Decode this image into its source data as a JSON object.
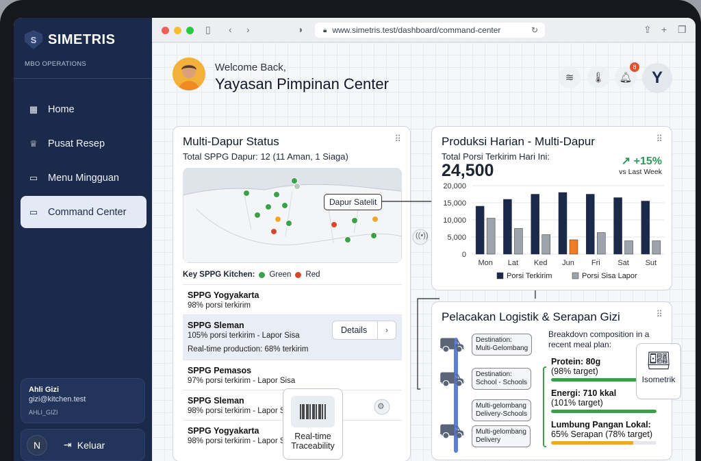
{
  "sidebar": {
    "brand": "SIMETRIS",
    "subtitle": "MBO OPERATIONS",
    "items": [
      {
        "label": "Home",
        "icon": "grid-icon"
      },
      {
        "label": "Pusat Resep",
        "icon": "chef-hat-icon"
      },
      {
        "label": "Menu Mingguan",
        "icon": "calendar-icon"
      },
      {
        "label": "Command Center",
        "icon": "calendar-icon"
      }
    ],
    "user": {
      "name": "Ahli Gizi",
      "email": "gizi@kitchen.test",
      "role": "AHLI_GIZI"
    },
    "logout": {
      "avatar": "N",
      "label": "Keluar"
    }
  },
  "browser": {
    "url": "www.simetris.test/dashboard/command-center"
  },
  "header": {
    "welcome": "Welcome Back,",
    "org": "Yayasan Pimpinan Center",
    "notifications": "8",
    "profile": "Y"
  },
  "status": {
    "title": "Multi-Dapur Status",
    "summary": "Total SPPG Dapur: 12 (11 Aman, 1 Siaga)",
    "callout": "Dapur Satelit",
    "key_label": "Key SPPG Kitchen:",
    "key_green": "Green",
    "key_red": "Red",
    "colors": {
      "green": "#3aa04a",
      "red": "#d9462e",
      "orange": "#f2a52b"
    },
    "rows": [
      {
        "name": "SPPG Yogyakarta",
        "detail": "98% porsi terkirim"
      },
      {
        "name": "SPPG Sleman",
        "detail": "105% porsi terkirim - Lapor Sisa",
        "extra": "Real-time production: 68% terkirim",
        "button": "Details"
      },
      {
        "name": "SPPG Pemasos",
        "detail": "97% porsi terkirim - Lapor Sisa"
      },
      {
        "name": "SPPG Sleman",
        "detail": "98% porsi terkirim - Lapor Sisa"
      },
      {
        "name": "SPPG Yogyakarta",
        "detail": "98% porsi terkirim - Lapor Sisa"
      }
    ],
    "trace_label_1": "Real-time",
    "trace_label_2": "Traceability"
  },
  "production": {
    "title": "Produksi Harian - Multi-Dapur",
    "subtitle": "Total Porsi Terkirim Hari Ini:",
    "total": "24,500",
    "trend": "+15%",
    "trend_note": "vs Last Week"
  },
  "chart_data": {
    "type": "bar",
    "categories": [
      "Mon",
      "Lat",
      "Ked",
      "Jun",
      "Fri",
      "Sat",
      "Sut"
    ],
    "series": [
      {
        "name": "Porsi Terkirim",
        "values": [
          14000,
          16000,
          17500,
          18000,
          17500,
          16500,
          15500
        ],
        "color": "#1b2a4a"
      },
      {
        "name": "Porsi Sisa Lapor",
        "values": [
          10500,
          7500,
          5700,
          4200,
          6300,
          3900,
          3900
        ],
        "color": "#9ea3ab"
      }
    ],
    "highlight": {
      "category": "Jun",
      "series": "Porsi Sisa Lapor",
      "color": "#f07d22"
    },
    "yticks": [
      "0",
      "5,000",
      "10,000",
      "15,000",
      "20,000"
    ],
    "ylim": [
      0,
      20000
    ],
    "grid": true,
    "legend": "bottom"
  },
  "logistics": {
    "title": "Pelacakan Logistik & Serapan Gizi",
    "tags": [
      [
        "Destination:",
        "Multi-Gelombang"
      ],
      [
        "Destination:",
        "School - Schools"
      ],
      [
        "Multi-gelombang",
        "Delivery-Schools"
      ],
      [
        "Multi-gelombang",
        "Delivery"
      ]
    ],
    "breakdown": "Breakdovn composition in a recent meal plan:",
    "iso": "Isometrik",
    "nutrients": [
      {
        "title": "Protein: 80g",
        "sub": "(98% target)",
        "pct": 0.98,
        "color": "#3aa04a"
      },
      {
        "title": "Energi: 710 kkal",
        "sub": "(101% target)",
        "pct": 1.0,
        "color": "#3aa04a"
      },
      {
        "title": "Lumbung Pangan Lokal:",
        "sub": "65% Serapan (78% target)",
        "pct": 0.65,
        "color": "#f2a52b"
      }
    ]
  }
}
